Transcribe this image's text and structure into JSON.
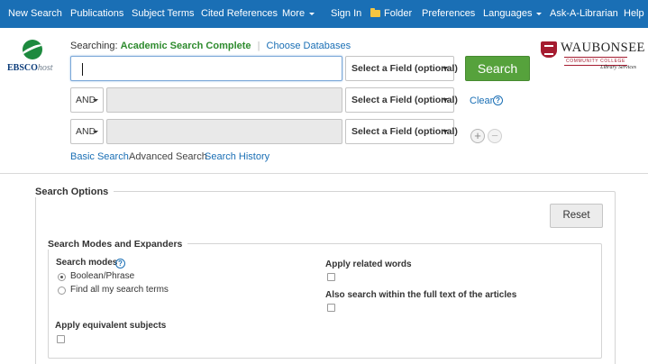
{
  "nav": {
    "items": [
      "New Search",
      "Publications",
      "Subject Terms",
      "Cited References",
      "More",
      "Sign In",
      "Folder",
      "Preferences",
      "Languages",
      "Ask-A-Librarian",
      "Help"
    ],
    "bg_color": "#1a6fb5"
  },
  "brand": {
    "ebsco_bold": "EBSCO",
    "ebsco_italic": "host",
    "library_name": "WAUBONSEE",
    "library_sub": "COMMUNITY COLLEGE",
    "library_tag": "Library Services"
  },
  "searching": {
    "label": "Searching:",
    "database": "Academic Search Complete",
    "choose": "Choose Databases"
  },
  "rows": [
    {
      "operator": "",
      "value": "",
      "field": "Select a Field (optional)"
    },
    {
      "operator": "AND",
      "value": "",
      "field": "Select a Field (optional)"
    },
    {
      "operator": "AND",
      "value": "",
      "field": "Select a Field (optional)"
    }
  ],
  "actions": {
    "search": "Search",
    "clear": "Clear",
    "help": "?",
    "add": "+",
    "remove": "−"
  },
  "modes": {
    "basic": "Basic Search",
    "advanced": "Advanced Search",
    "history": "Search History"
  },
  "options": {
    "title": "Search Options",
    "reset": "Reset",
    "expanders_title": "Search Modes and Expanders",
    "search_modes_label": "Search modes",
    "radio_boolean": "Boolean/Phrase",
    "radio_all": "Find all my search terms",
    "related_words": "Apply related words",
    "full_text": "Also search within the full text of the articles",
    "equivalent": "Apply equivalent subjects"
  }
}
